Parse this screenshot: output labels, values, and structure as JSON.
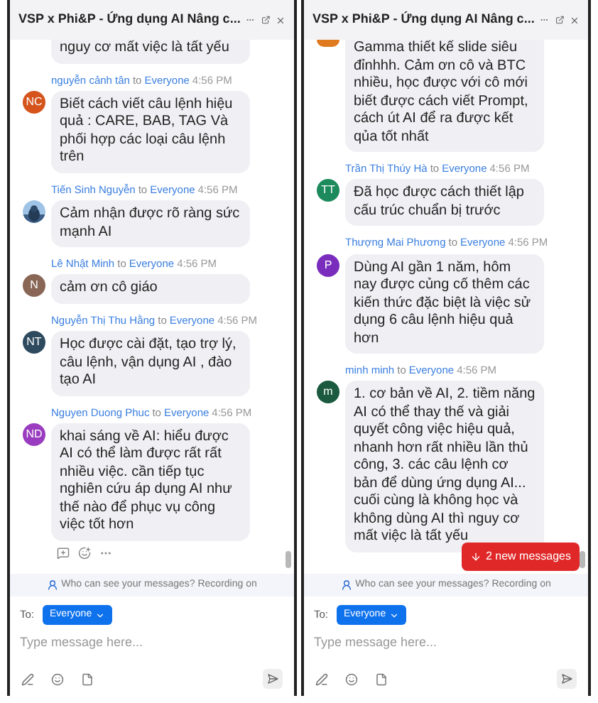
{
  "panels": [
    {
      "title": "VSP x Phi&P - Ứng dụng AI Nâng c...",
      "messages": [
        {
          "kind": "cut",
          "text": "nguy cơ mất việc là tất yếu"
        },
        {
          "kind": "full",
          "sender": "nguyễn cảnh tân",
          "to": "to",
          "recipient": "Everyone",
          "time": "4:56 PM",
          "avatar": {
            "kind": "initials",
            "initials": "NC",
            "color": "#d4541c"
          },
          "text": "Biết cách viết câu lệnh hiệu quả : CARE, BAB, TAG Và phối hợp các loại câu lệnh trên"
        },
        {
          "kind": "full",
          "sender": "Tiến Sinh Nguyễn",
          "to": "to",
          "recipient": "Everyone",
          "time": "4:56 PM",
          "text": "Cảm nhận được rõ ràng sức mạnh AI"
        },
        {
          "kind": "full",
          "sender": "Lê Nhật Minh",
          "to": "to",
          "recipient": "Everyone",
          "time": "4:56 PM",
          "avatar": {
            "kind": "initials",
            "initials": "N",
            "color": "#8a6656"
          },
          "text": "cảm ơn cô giáo"
        },
        {
          "kind": "full",
          "sender": "Nguyễn Thị Thu Hằng",
          "to": "to",
          "recipient": "Everyone",
          "time": "4:56 PM",
          "avatar": {
            "kind": "initials",
            "initials": "NT",
            "color": "#2e4a5e"
          },
          "text": "Học được cài đặt, tạo trợ lý, câu lệnh, vận dụng AI , đào tạo AI"
        },
        {
          "kind": "full",
          "sender": "Nguyen Duong Phuc",
          "to": "to",
          "recipient": "Everyone",
          "time": "4:56 PM",
          "avatar": {
            "kind": "initials",
            "initials": "ND",
            "color": "#9a3cbf"
          },
          "text": "khai sáng về AI: hiểu được AI có thể làm được rất rất nhiều việc. cần tiếp tục nghiên cứu áp dụng AI như thế nào để phục vụ công việc tốt hơn",
          "reactions": true
        }
      ],
      "notice": "Who can see your messages? Recording on",
      "to_label": "To:",
      "recipient": "Everyone",
      "placeholder": "Type message here..."
    },
    {
      "title": "VSP x Phi&P - Ứng dụng AI Nâng c...",
      "messages": [
        {
          "kind": "cut",
          "color": "#e07a1f",
          "text": "Gamma thiết kế slide siêu đỉnhhh. Cảm ơn cô và BTC nhiều, học được với cô mới biết được cách viết Prompt, cách út AI để ra được kết qủa tốt nhất"
        },
        {
          "kind": "full",
          "sender": "Trần Thị Thúy Hà",
          "to": "to",
          "recipient": "Everyone",
          "time": "4:56 PM",
          "avatar": {
            "kind": "initials",
            "initials": "TT",
            "color": "#1d8a5c"
          },
          "text": "Đã học được cách thiết lập cấu trúc chuẩn bị trước"
        },
        {
          "kind": "full",
          "sender": "Thượng Mai Phương",
          "to": "to",
          "recipient": "Everyone",
          "time": "4:56 PM",
          "avatar": {
            "kind": "initials",
            "initials": "P",
            "color": "#7a2dbd"
          },
          "text": "Dùng AI gần 1 năm, hôm nay được củng cố thêm các kiến thức đặc biệt là việc sử dụng 6 câu lệnh hiệu quả hơn"
        },
        {
          "kind": "full",
          "sender": "minh minh",
          "to": "to",
          "recipient": "Everyone",
          "time": "4:56 PM",
          "avatar": {
            "kind": "initials",
            "initials": "m",
            "color": "#1b5a3e"
          },
          "text": "1. cơ bản về AI, 2. tiềm năng AI có thể thay thế và giải quyết công việc hiệu quả, nhanh hơn rất nhiều lần thủ công, 3. các câu lệnh cơ bản để dùng ứng dụng AI... cuối cùng là không học và không dùng AI thì nguy cơ mất việc là tất yếu"
        }
      ],
      "new_messages": "2 new messages",
      "notice": "Who can see your messages? Recording on",
      "to_label": "To:",
      "recipient": "Everyone",
      "placeholder": "Type message here..."
    }
  ]
}
